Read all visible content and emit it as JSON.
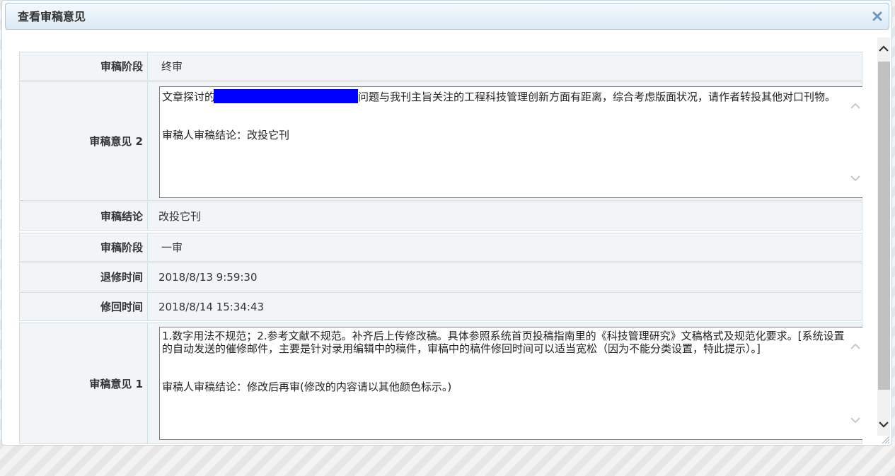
{
  "dialog": {
    "title": "查看审稿意见"
  },
  "rows": {
    "stage_final": {
      "label": "审稿阶段",
      "value": "终审"
    },
    "opinion2": {
      "label": "审稿意见 2",
      "text_before": "文章探讨的",
      "text_after": "问题与我刊主旨关注的工程科技管理创新方面有距离，综合考虑版面状况，请作者转投其他对口刊物。",
      "conclusion": "审稿人审稿结论：改投它刊"
    },
    "conclusion": {
      "label": "审稿结论",
      "value": "改投它刊"
    },
    "stage_first": {
      "label": "审稿阶段",
      "value": "一审"
    },
    "return_time": {
      "label": "退修时间",
      "value": "2018/8/13 9:59:30"
    },
    "revise_time": {
      "label": "修回时间",
      "value": "2018/8/14 15:34:43"
    },
    "opinion1": {
      "label": "审稿意见 1",
      "text": "1.数字用法不规范；2.参考文献不规范。补齐后上传修改稿。具体参照系统首页投稿指南里的《科技管理研究》文稿格式及规范化要求。[系统设置的自动发送的催修邮件，主要是针对录用编辑中的稿件，审稿中的稿件修回时间可以适当宽松（因为不能分类设置，特此提示）。]",
      "conclusion": "审稿人审稿结论：修改后再审(修改的内容请以其他颜色标示。)"
    }
  },
  "colors": {
    "title_gradient_top": "#f4f9fd",
    "title_gradient_bottom": "#dbe9f5",
    "row_background": "#f2f5f8",
    "row_border": "#cfe0e6",
    "redaction": "#0000ff"
  },
  "icons": {
    "close": "close-icon",
    "scroll_up": "chevron-up-icon",
    "scroll_down": "chevron-down-icon",
    "resize": "resize-grip-icon"
  }
}
